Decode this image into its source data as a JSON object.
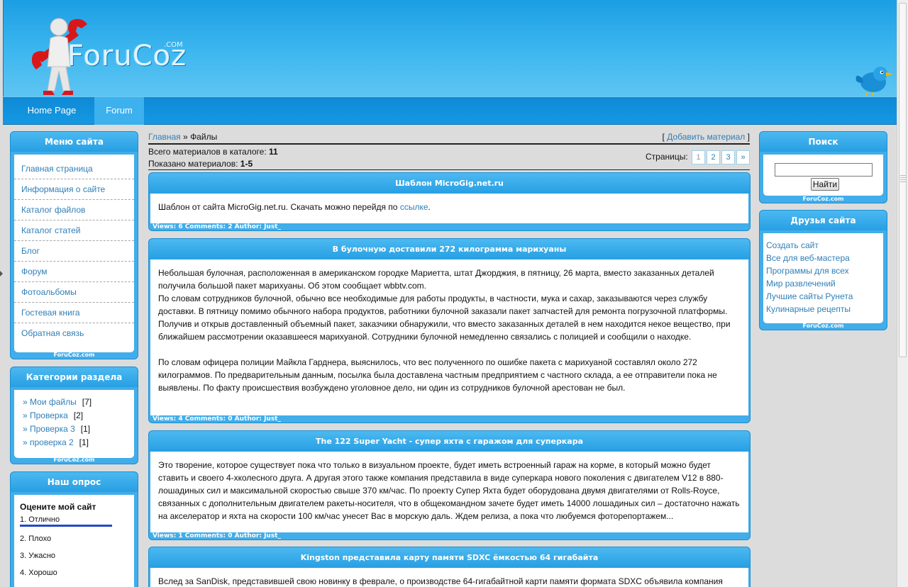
{
  "site": {
    "logo_text": "ForuCoz",
    "logo_com": ".COM",
    "logo_icon": "wrench-man-icon",
    "bird_icon": "twitter-bird-icon"
  },
  "nav": {
    "home": "Home Page",
    "forum": "Forum"
  },
  "left": {
    "menu": {
      "title": "Меню сайта",
      "items": [
        "Главная страница",
        "Информация о сайте",
        "Каталог файлов",
        "Каталог статей",
        "Блог",
        "Форум",
        "Фотоальбомы",
        "Гостевая книга",
        "Обратная связь"
      ],
      "footer": "ForuCoz.com"
    },
    "categories": {
      "title": "Категории раздела",
      "items": [
        {
          "label": "» Мои файлы",
          "count": "[7]"
        },
        {
          "label": "» Проверка",
          "count": "[2]"
        },
        {
          "label": "» Проверка 3",
          "count": "[1]"
        },
        {
          "label": "» проверка 2",
          "count": "[1]"
        }
      ],
      "footer": "ForuCoz.com"
    },
    "poll": {
      "title": "Наш опрос",
      "question": "Оцените мой сайт",
      "options": [
        "1. Отлично",
        "2. Плохо",
        "3. Ужасно",
        "4. Хорошо"
      ],
      "first_option_share": 1.0
    }
  },
  "center": {
    "breadcrumb_home": "Главная",
    "breadcrumb_sep": "»",
    "breadcrumb_current": "Файлы",
    "add_material": "Добавить материал",
    "add_open": "[",
    "add_close": "]",
    "total_label": "Всего материалов в каталоге:",
    "total_value": "11",
    "shown_label": "Показано материалов:",
    "shown_value": "1-5",
    "pages_label": "Страницы:",
    "pages": [
      "1",
      "2",
      "3",
      "»"
    ],
    "entries": [
      {
        "title": "Шаблон MicroGig.net.ru",
        "text_before": "Шаблон от сайта MicroGig.net.ru. Скачать можно перейдя по ",
        "link": "ссылке",
        "text_after": ".",
        "footer": "Views: 6 Comments: 2 Author: Just_"
      },
      {
        "title": "В булочную доставили 272 килограмма марихуаны",
        "paragraphs": [
          "Небольшая булочная, расположенная в американском городке Мариетта, штат Джорджия, в пятницу, 26 марта, вместо заказанных деталей получила большой пакет марихуаны. Об этом сообщает wbbtv.com.",
          "По словам сотрудников булочной, обычно все необходимые для работы продукты, в частности, мука и сахар, заказываются через службу доставки. В пятницу помимо обычного набора продуктов, работники булочной заказали пакет запчастей для ремонта погрузочной платформы. Получив и открыв доставленный объемный пакет, заказчики обнаружили, что вместо заказанных деталей в нем находится некое вещество, при ближайшем рассмотрении оказавшееся марихуаной. Сотрудники булочной немедленно связались с полицией и сообщили о находке.",
          "По словам офицера полиции Майкла Гарднера, выяснилось, что вес полученного по ошибке пакета с марихуаной составлял около 272 килограммов. По предварительным данным, посылка была доставлена частным предприятием с частного склада, а ее отправители пока не выявлены. По факту происшествия возбуждено уголовное дело, ни один из сотрудников булочной арестован не был."
        ],
        "footer": "Views: 4 Comments: 0 Author: Just_"
      },
      {
        "title": "The 122 Super Yacht - супер яхта с гаражом для суперкара",
        "text": "Это творение, которое существует пока что только в визуальном проекте, будет иметь встроенный гараж на корме, в который можно будет ставить и своего 4-хколесного друга. А другая этого также компания представила в виде суперкара нового поколения с двигателем V12 в 880-лошадиных сил и максимальной скоростью свыше 370 км/час. По проекту Супер Яхта будет оборудована двумя двигателями от Rolls-Royce, связанных с дополнительным двигателем ракеты-носителя, что в общекомандном зачете будет иметь 14000 лошадиных сил – достаточно нажать на акселератор и яхта на скорости 100 км/час унесет Вас в морскую даль. Ждем релиза, а пока что любуемся фоторепортажем...",
        "footer": "Views: 1 Comments: 0 Author: Just_"
      },
      {
        "title": "Kingston представила карту памяти SDXC ёмкостью 64 гигабайта",
        "text": "Вслед за SanDisk, представившей свою новинку в феврале, о производстве 64-гигабайтной карти памяти формата SDXC объявила компания"
      }
    ]
  },
  "right": {
    "search": {
      "title": "Поиск",
      "button": "Найти",
      "value": "",
      "footer": "ForuCoz.com"
    },
    "friends": {
      "title": "Друзья сайта",
      "items": [
        "Создать сайт",
        "Все для веб-мастера",
        "Программы для всех",
        "Мир развлечений",
        "Лучшие сайты Рунета",
        "Кулинарные рецепты"
      ],
      "footer": "ForuCoz.com"
    }
  },
  "colors": {
    "accent": "#2f7fb8",
    "header_blue": "#3cb6ef",
    "box_blue": "#41adea",
    "poll_bar": "#2149c8"
  }
}
